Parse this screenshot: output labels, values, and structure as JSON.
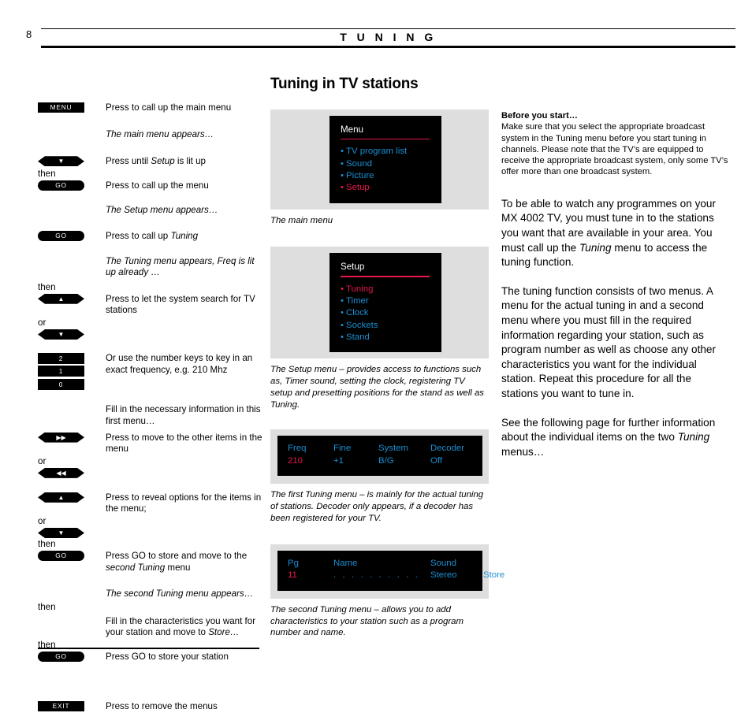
{
  "header": {
    "page_number": "8",
    "title": "T U N I N G"
  },
  "section": {
    "title": "Tuning in TV stations"
  },
  "steps": [
    {
      "button": "MENU",
      "shape": "rect",
      "connector": "",
      "text": "Press to call up the main menu"
    },
    {
      "button": null,
      "connector": "",
      "text": "The main menu appears…",
      "italic": true
    },
    {
      "button": "▼",
      "shape": "hex",
      "connector": "",
      "text": "Press until Setup is lit up",
      "emphasis": "Setup"
    },
    {
      "button": "GO",
      "shape": "pill",
      "connector": "then",
      "text": "Press to call up the menu"
    },
    {
      "button": null,
      "connector": "",
      "text": "The Setup menu appears…",
      "italic": true
    },
    {
      "button": "GO",
      "shape": "pill",
      "connector": "",
      "text": "Press to call up Tuning",
      "emphasis": "Tuning"
    },
    {
      "button": null,
      "connector": "",
      "text": "The Tuning menu appears, Freq is lit up already …",
      "italic": true
    },
    {
      "button": "▲",
      "shape": "hex",
      "connector": "then",
      "text": "Press to let the system search for TV stations"
    },
    {
      "button": "▼",
      "shape": "hex",
      "connector": "or",
      "text": ""
    },
    {
      "button": "2",
      "shape": "numkey",
      "connector": "",
      "text": "Or use the number keys to key in an exact frequency, e.g. 210 Mhz"
    },
    {
      "button": "1",
      "shape": "numkey",
      "connector": "",
      "text": ""
    },
    {
      "button": "0",
      "shape": "numkey",
      "connector": "",
      "text": ""
    },
    {
      "button": null,
      "connector": "",
      "text": "Fill in the necessary information in this first menu…"
    },
    {
      "button": "▶▶",
      "shape": "hex",
      "connector": "",
      "text": "Press to move to the other items in the menu"
    },
    {
      "button": "◀◀",
      "shape": "hex",
      "connector": "or",
      "text": ""
    },
    {
      "button": "▲",
      "shape": "hex",
      "connector": "",
      "text": "Press to reveal options for the items in the menu;"
    },
    {
      "button": "▼",
      "shape": "hex",
      "connector": "or",
      "text": ""
    },
    {
      "button": "GO",
      "shape": "pill",
      "connector": "then",
      "text": "Press GO to store and move to the second Tuning menu",
      "emphasis": "second Tuning"
    },
    {
      "button": null,
      "connector": "",
      "text": "The second Tuning menu appears…",
      "italic": true
    },
    {
      "button": null,
      "connector": "then",
      "text": "Fill in the characteristics you want for your station and move to Store…",
      "emphasis": "Store…"
    },
    {
      "button": "GO",
      "shape": "pill",
      "connector": "then",
      "text": "Press GO to store your station"
    },
    {
      "button": "EXIT",
      "shape": "rect",
      "connector": "",
      "text": "Press to remove the menus"
    }
  ],
  "step_labels": {
    "menu_button": "MENU",
    "go_button": "GO",
    "exit_button": "EXIT",
    "key_2": "2",
    "key_1": "1",
    "key_0": "0",
    "then": "then",
    "or": "or",
    "down_arrow": "▼",
    "up_arrow": "▲",
    "forward_arrow": "▶▶",
    "back_arrow": "◀◀"
  },
  "step_text": {
    "s1": "Press to call up the main menu",
    "s2": "The main menu appears…",
    "s3_a": "Press until ",
    "s3_em": "Setup",
    "s3_b": " is lit up",
    "s4": "Press to call up the menu",
    "s5_a": "The Setup menu appears…",
    "s6_a": "Press to call up ",
    "s6_em": "Tuning",
    "s7": "The Tuning menu appears, Freq is lit up already …",
    "s8": "Press to let the system search for TV stations",
    "s9": "Or use the number keys to key in an exact frequency, e.g. 210 Mhz",
    "s10": "Fill in the necessary information in this first menu…",
    "s11": "Press to move to the other items in the menu",
    "s12": "Press to reveal options for the items in the menu;",
    "s13_a": "Press GO to store and move to the ",
    "s13_em": "second Tuning",
    "s13_b": " menu",
    "s14": "The second Tuning menu appears…",
    "s15_a": "Fill in the characteristics you want for your station and move to ",
    "s15_em": "Store…",
    "s16": "Press GO to store your station",
    "s17": "Press to remove the menus"
  },
  "main_menu": {
    "heading": "Menu",
    "items": [
      {
        "label": "TV program list",
        "highlighted": false
      },
      {
        "label": "Sound",
        "highlighted": false
      },
      {
        "label": "Picture",
        "highlighted": false
      },
      {
        "label": "Setup",
        "highlighted": true
      }
    ],
    "caption": "The main menu"
  },
  "setup_menu": {
    "heading": "Setup",
    "items": [
      {
        "label": "Tuning",
        "highlighted": true
      },
      {
        "label": "Timer",
        "highlighted": false
      },
      {
        "label": "Clock",
        "highlighted": false
      },
      {
        "label": "Sockets",
        "highlighted": false
      },
      {
        "label": "Stand",
        "highlighted": false
      }
    ],
    "caption": "The Setup menu – provides access to functions such as, Timer sound, setting the clock, registering TV setup and presetting positions for the stand as well as Tuning."
  },
  "tuning_menu_1": {
    "headers": [
      "Freq",
      "Fine",
      "System",
      "Decoder"
    ],
    "values": [
      "210",
      "+1",
      "B/G",
      "Off"
    ],
    "caption": "The first Tuning menu – is mainly for the actual tuning of stations. Decoder only appears, if a decoder has been registered for your TV."
  },
  "tuning_menu_2": {
    "headers": [
      "Pg",
      "Name",
      "Sound",
      ""
    ],
    "values": [
      "11",
      ". . . . . . . . . .",
      "Stereo",
      "Store"
    ],
    "caption": "The second Tuning menu – allows you to add characteristics to your station such as a program number and name."
  },
  "sidebar_note": {
    "heading": "Before you start…",
    "body": "Make sure that you select the appropriate broadcast system in the Tuning menu before you start tuning in channels. Please note that the TV’s are equipped to receive the appropriate broadcast system, only some TV’s offer more than one broadcast system."
  },
  "body_text": {
    "p1_a": "To be able to watch any programmes on your MX 4002 TV, you must tune in to the stations you want that are available in your area. You must call up the ",
    "p1_em": "Tuning",
    "p1_b": " menu to access the tuning function.",
    "p2": "The tuning function consists of two menus. A menu for the actual tuning in and a second menu where you must fill in the required information regarding your station, such as program number as well as choose any other characteristics you want for the individual station. Repeat this procedure for all the stations you want to tune in.",
    "p3_a": "See the following page for further information about the individual items on the two ",
    "p3_em": "Tuning",
    "p3_b": " menus…"
  },
  "colors": {
    "osd_blue": "#1b8ed2",
    "osd_red": "#e8174a",
    "panel_grey": "#dedede",
    "screen_black": "#000000"
  }
}
